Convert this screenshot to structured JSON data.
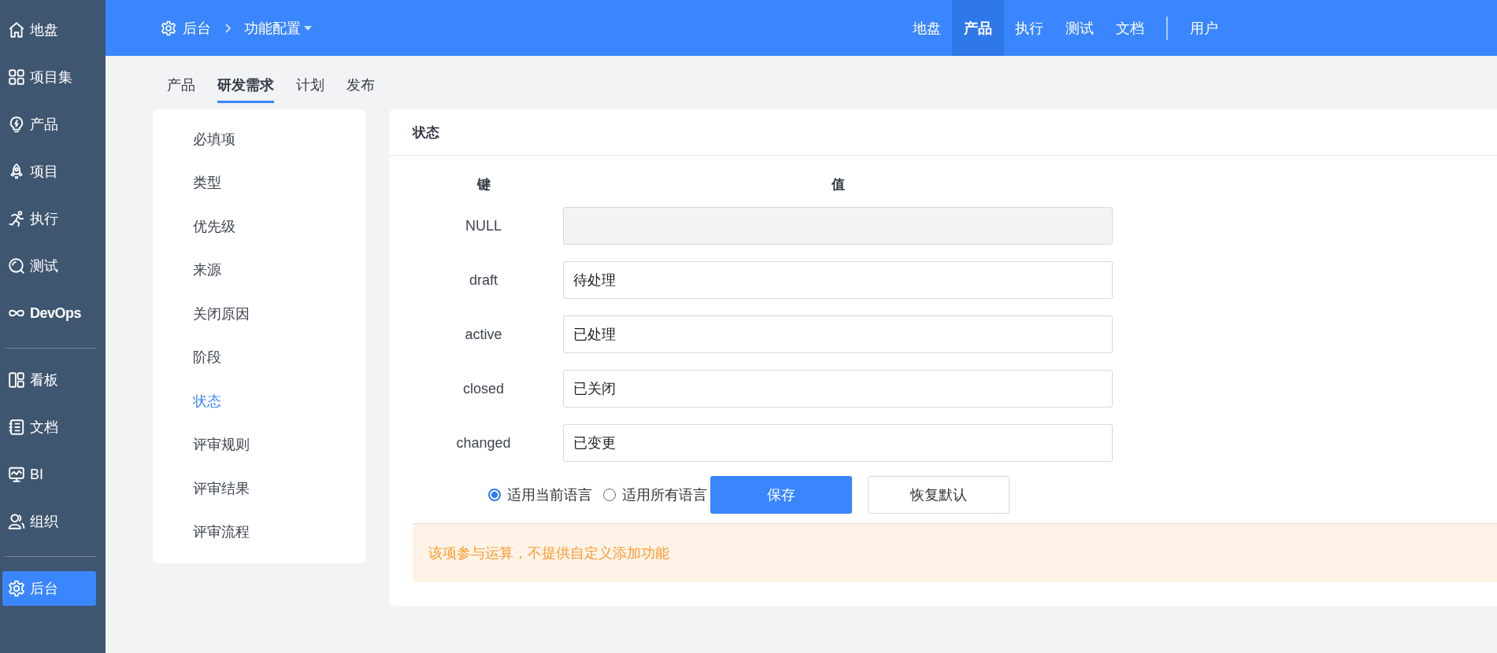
{
  "sidebar": {
    "groups": [
      [
        {
          "label": "地盘",
          "selected": false
        },
        {
          "label": "项目集",
          "selected": false
        },
        {
          "label": "产品",
          "selected": false
        },
        {
          "label": "项目",
          "selected": false
        },
        {
          "label": "执行",
          "selected": false
        },
        {
          "label": "测试",
          "selected": false
        },
        {
          "label": "DevOps",
          "selected": false
        }
      ],
      [
        {
          "label": "看板",
          "selected": false
        },
        {
          "label": "文档",
          "selected": false
        },
        {
          "label": "BI",
          "selected": false
        },
        {
          "label": "组织",
          "selected": false
        }
      ],
      [
        {
          "label": "后台",
          "selected": true
        }
      ]
    ]
  },
  "breadcrumb": {
    "items": [
      "后台",
      "功能配置"
    ]
  },
  "top_nav": {
    "items": [
      {
        "label": "地盘",
        "selected": false
      },
      {
        "label": "产品",
        "selected": true
      },
      {
        "label": "执行",
        "selected": false
      },
      {
        "label": "测试",
        "selected": false
      },
      {
        "label": "文档",
        "selected": false
      }
    ],
    "user": "用户"
  },
  "sub_tabs": [
    {
      "label": "产品",
      "selected": false
    },
    {
      "label": "研发需求",
      "selected": true
    },
    {
      "label": "计划",
      "selected": false
    },
    {
      "label": "发布",
      "selected": false
    }
  ],
  "menu": [
    {
      "label": "必填项",
      "selected": false
    },
    {
      "label": "类型",
      "selected": false
    },
    {
      "label": "优先级",
      "selected": false
    },
    {
      "label": "来源",
      "selected": false
    },
    {
      "label": "关闭原因",
      "selected": false
    },
    {
      "label": "阶段",
      "selected": false
    },
    {
      "label": "状态",
      "selected": true
    },
    {
      "label": "评审规则",
      "selected": false
    },
    {
      "label": "评审结果",
      "selected": false
    },
    {
      "label": "评审流程",
      "selected": false
    }
  ],
  "panel": {
    "title": "状态",
    "columns": [
      "键",
      "值"
    ],
    "rows": [
      {
        "key": "NULL",
        "disabled": true
      },
      {
        "key": "draft",
        "value": "待处理",
        "disabled": false
      },
      {
        "key": "active",
        "value": "已处理",
        "disabled": false
      },
      {
        "key": "closed",
        "value": "已关闭",
        "disabled": false
      },
      {
        "key": "changed",
        "value": "已变更",
        "disabled": false
      }
    ],
    "language_options": [
      {
        "label": "适用当前语言",
        "selected": true
      },
      {
        "label": "适用所有语言",
        "selected": false
      }
    ],
    "buttons": [
      {
        "label": "保存",
        "kind": "primary"
      },
      {
        "label": "恢复默认",
        "kind": "default"
      }
    ],
    "notice": "该项参与运算，不提供自定义添加功能"
  }
}
